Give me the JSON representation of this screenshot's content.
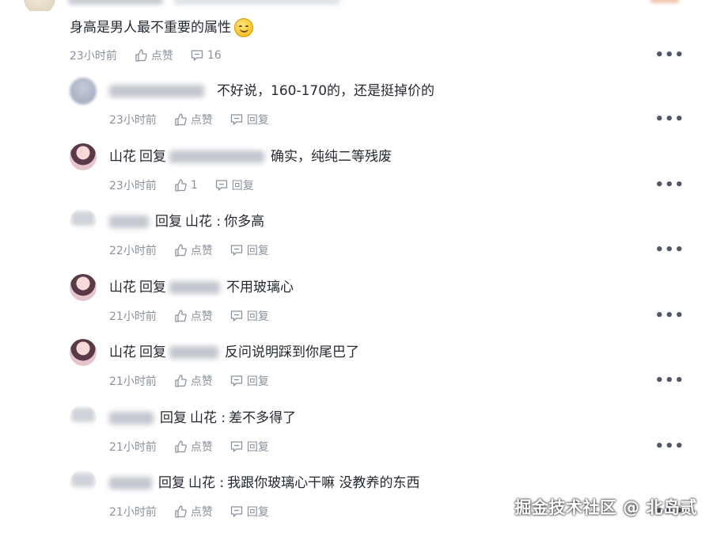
{
  "main_comment": {
    "text": "身高是男人最不重要的属性",
    "emoji": "smiling-face-emoji",
    "time": "23小时前",
    "like_label": "点赞",
    "reply_count": "16",
    "more": "•••"
  },
  "replies": [
    {
      "author": "",
      "reply_word": "",
      "target": "",
      "text": "不好说，160-170的，还是挺掉价的",
      "time": "23小时前",
      "like_label": "点赞",
      "reply_label": "回复",
      "more": "•••"
    },
    {
      "author": "山花",
      "reply_word": "回复",
      "target": "",
      "text": "确实，纯纯二等残废",
      "time": "23小时前",
      "like_label": "1",
      "reply_label": "回复",
      "more": "•••"
    },
    {
      "author": "",
      "reply_word": "回复",
      "target": "山花 :",
      "text": "你多高",
      "time": "22小时前",
      "like_label": "点赞",
      "reply_label": "回复",
      "more": "•••"
    },
    {
      "author": "山花",
      "reply_word": "回复",
      "target": "",
      "text": "不用玻璃心",
      "time": "21小时前",
      "like_label": "点赞",
      "reply_label": "回复",
      "more": "•••"
    },
    {
      "author": "山花",
      "reply_word": "回复",
      "target": "",
      "text": "反问说明踩到你尾巴了",
      "time": "21小时前",
      "like_label": "点赞",
      "reply_label": "回复",
      "more": "•••"
    },
    {
      "author": "",
      "reply_word": "回复",
      "target": "山花 :",
      "text": "差不多得了",
      "time": "21小时前",
      "like_label": "点赞",
      "reply_label": "回复",
      "more": "•••"
    },
    {
      "author": "",
      "reply_word": "回复",
      "target": "山花 :",
      "text": "我跟你玻璃心干嘛 没教养的东西",
      "time": "21小时前",
      "like_label": "点赞",
      "reply_label": "回复",
      "more": "•••"
    }
  ],
  "watermark": "掘金技术社区 @ 北岛贰"
}
